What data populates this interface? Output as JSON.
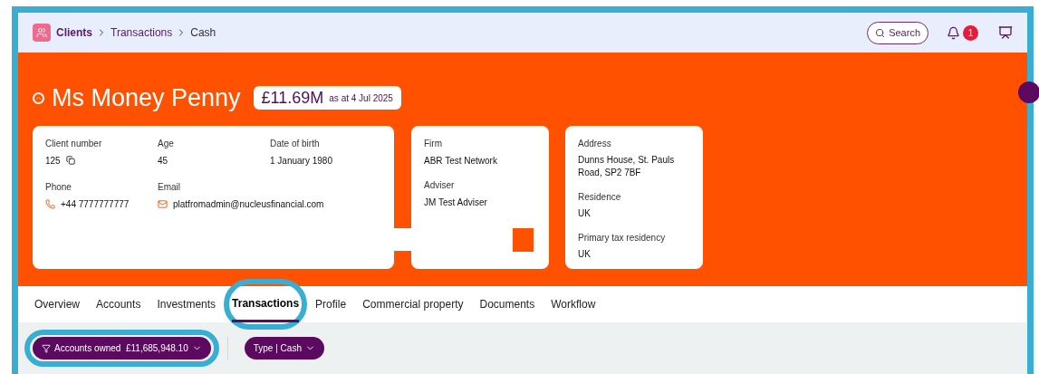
{
  "breadcrumb": [
    {
      "label": "Clients",
      "kind": "root"
    },
    {
      "label": "Transactions",
      "kind": "link"
    },
    {
      "label": "Cash",
      "kind": "current"
    }
  ],
  "header": {
    "search_label": "Search",
    "notification_count": "1"
  },
  "client": {
    "name": "Ms Money Penny",
    "value": "£11.69M",
    "as_at": "as at 4 Jul 2025"
  },
  "details_card": [
    {
      "label": "Client number",
      "value": "125",
      "kind": "copy"
    },
    {
      "label": "Age",
      "value": "45",
      "kind": "plain"
    },
    {
      "label": "Date of birth",
      "value": "1 January 1980",
      "kind": "plain"
    },
    {
      "label": "Phone",
      "value": "+44 7777777777",
      "kind": "phone"
    },
    {
      "label": "Email",
      "value": "platfromadmin@nucleusfinancial.com",
      "kind": "email"
    }
  ],
  "firm_card": [
    {
      "label": "Firm",
      "value": "ABR Test Network"
    },
    {
      "label": "Adviser",
      "value": "JM Test Adviser"
    }
  ],
  "address_card": [
    {
      "label": "Address",
      "value": "Dunns House, St. Pauls Road, SP2 7BF"
    },
    {
      "label": "Residence",
      "value": "UK"
    },
    {
      "label": "Primary tax residency",
      "value": "UK"
    }
  ],
  "tabs": [
    {
      "label": "Overview",
      "selected": false,
      "highlighted": false
    },
    {
      "label": "Accounts",
      "selected": false,
      "highlighted": false
    },
    {
      "label": "Investments",
      "selected": false,
      "highlighted": false
    },
    {
      "label": "Transactions",
      "selected": true,
      "highlighted": true
    },
    {
      "label": "Profile",
      "selected": false,
      "highlighted": false
    },
    {
      "label": "Commercial property",
      "selected": false,
      "highlighted": false
    },
    {
      "label": "Documents",
      "selected": false,
      "highlighted": false
    },
    {
      "label": "Workflow",
      "selected": false,
      "highlighted": false
    }
  ],
  "filters": [
    {
      "kind": "accounts",
      "label": "Accounts owned",
      "value": "£11,685,948.10",
      "highlighted": true
    },
    {
      "kind": "type",
      "label": "Type",
      "separator": "|",
      "value": "Cash",
      "highlighted": false
    }
  ]
}
